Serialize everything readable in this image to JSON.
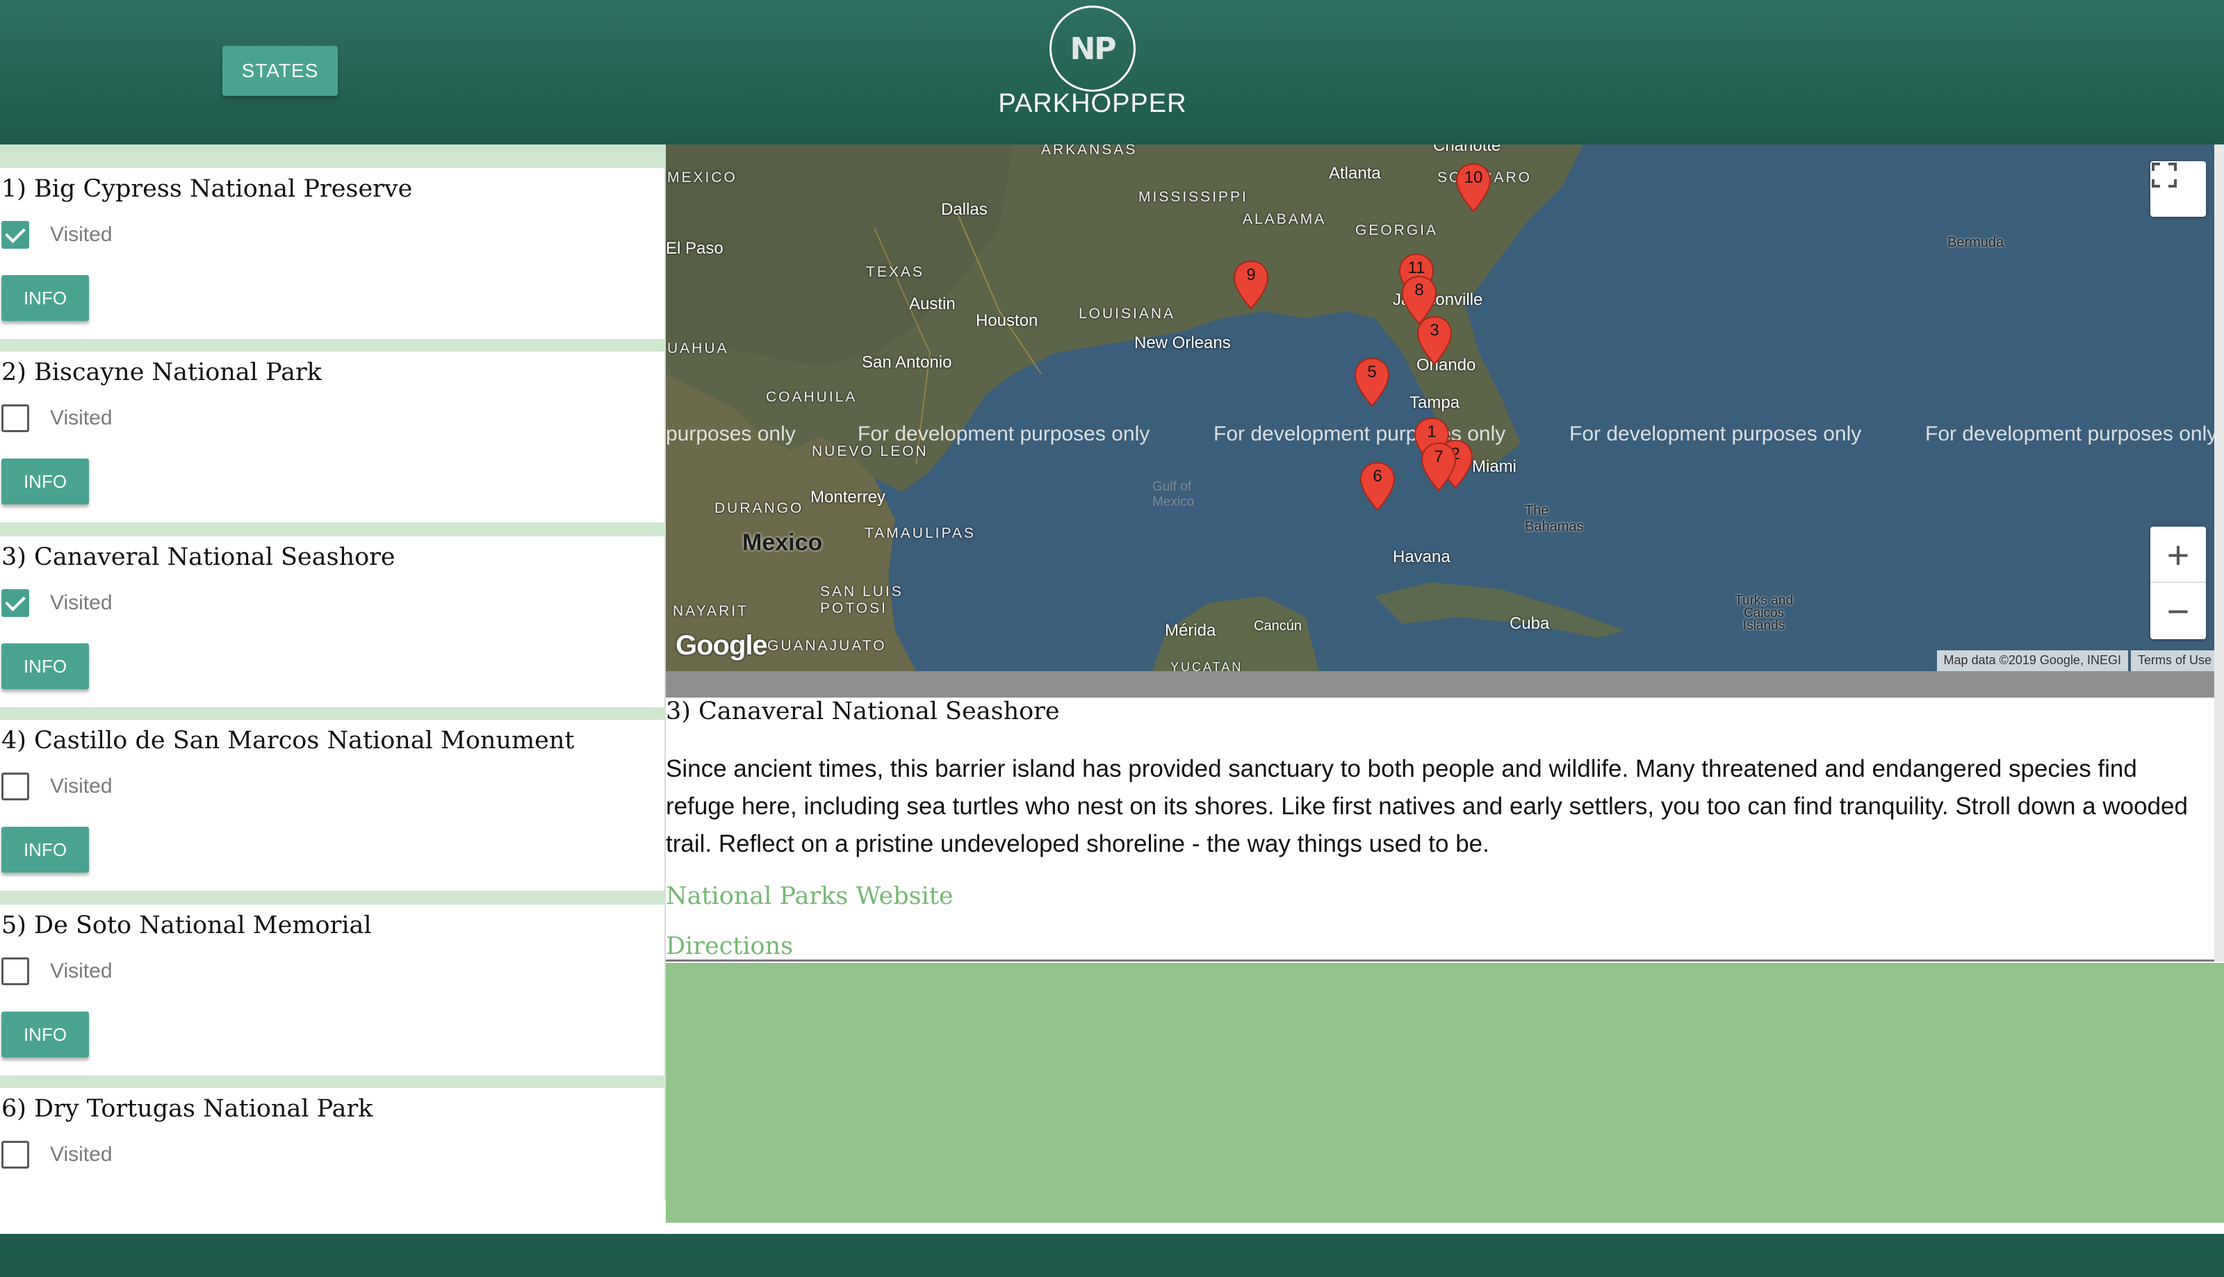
{
  "header": {
    "states_label": "STATES",
    "logo_initials": "NP",
    "app_name": "PARKHOPPER",
    "brand_color": "#1f5a4c",
    "accent_color": "#4aa391"
  },
  "parks": [
    {
      "title": "1) Big Cypress National Preserve",
      "visited_label": "Visited",
      "visited": true,
      "info_label": "INFO"
    },
    {
      "title": "2) Biscayne National Park",
      "visited_label": "Visited",
      "visited": false,
      "info_label": "INFO"
    },
    {
      "title": "3) Canaveral National Seashore",
      "visited_label": "Visited",
      "visited": true,
      "info_label": "INFO"
    },
    {
      "title": "4) Castillo de San Marcos National Monument",
      "visited_label": "Visited",
      "visited": false,
      "info_label": "INFO"
    },
    {
      "title": "5) De Soto National Memorial",
      "visited_label": "Visited",
      "visited": false,
      "info_label": "INFO"
    },
    {
      "title": "6) Dry Tortugas National Park",
      "visited_label": "Visited",
      "visited": false,
      "info_label": "INFO"
    }
  ],
  "map": {
    "places": {
      "arkansas": "ARKANSAS",
      "mexico_state": "MEXICO",
      "dallas": "Dallas",
      "el_paso": "El Paso",
      "texas": "TEXAS",
      "austin": "Austin",
      "houston": "Houston",
      "louisiana": "LOUISIANA",
      "mississippi": "MISSISSIPPI",
      "alabama": "ALABAMA",
      "georgia": "GEORGIA",
      "atlanta": "Atlanta",
      "south_carolina": "SOU CARO",
      "charlotte": "Charlotte",
      "new_orleans": "New Orleans",
      "san_antonio": "San Antonio",
      "coahuila": "COAHUILA",
      "chihuahua": "UAHUA",
      "nuevo_leon": "NUEVO LEON",
      "monterrey": "Monterrey",
      "durango": "DURANGO",
      "mexico": "Mexico",
      "tamaulipas": "TAMAULIPAS",
      "san_luis_potosi": "SAN LUIS POTOSI",
      "nayarit": "NAYARIT",
      "guanajuato": "GUANAJUATO",
      "jacksonville": "Jacksonville",
      "orlando": "Orlando",
      "tampa": "Tampa",
      "miami": "Miami",
      "gulf_of_mexico": "Gulf of Mexico",
      "the_bahamas": "The Bahamas",
      "havana": "Havana",
      "cuba": "Cuba",
      "merida": "Mérida",
      "cancun": "Cancún",
      "yucatan": "YUCATAN",
      "turks_caicos": "Turks and Caicos Islands",
      "bermuda": "Bermuda"
    },
    "dev_watermark": "For development purposes only",
    "dev_watermark_partial": "purposes only",
    "markers": [
      "1",
      "2",
      "3",
      "5",
      "6",
      "7",
      "8",
      "9",
      "10",
      "11"
    ],
    "attribution": "Map data ©2019 Google, INEGI",
    "terms": "Terms of Use",
    "google_logo": "Google",
    "zoom_in": "+",
    "zoom_out": "−"
  },
  "detail": {
    "title": "3) Canaveral National Seashore",
    "description": "Since ancient times, this barrier island has provided sanctuary to both people and wildlife. Many threatened and endangered species find refuge here, including sea turtles who nest on its shores. Like first natives and early settlers, you too can find tranquility. Stroll down a wooded trail. Reflect on a pristine undeveloped shoreline - the way things used to be.",
    "website_label": "National Parks Website",
    "directions_label": "Directions"
  }
}
